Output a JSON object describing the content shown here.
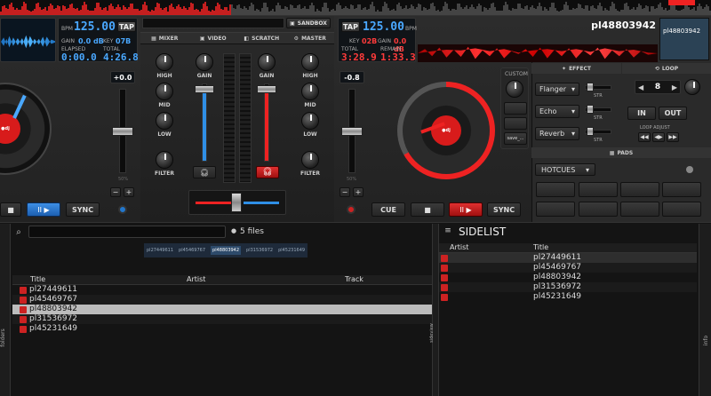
{
  "top_bar": {
    "sandbox_label": "SANDBOX"
  },
  "left_deck": {
    "bpm_label": "BPM",
    "bpm": "125.00",
    "tap": "TAP",
    "gain_label": "GAIN",
    "gain": "0.0 dB",
    "key_label": "KEY",
    "key": "07B",
    "elapsed_label": "ELAPSED",
    "elapsed": "0:00.0",
    "total_label": "TOTAL",
    "total": "4:26.8",
    "pitch": "+0.0",
    "pitch_pct": "50%",
    "sync": "SYNC"
  },
  "right_deck": {
    "tap": "TAP",
    "bpm": "125.00",
    "bpm_label": "BPM",
    "key_label": "KEY",
    "key": "02B",
    "gain_label": "GAIN",
    "gain": "0.0 dB",
    "total_label": "TOTAL",
    "total": "3:28.9",
    "remain_label": "REMAIN",
    "remain": "1:33.3",
    "title": "pl48803942",
    "cover_title": "pl48803942",
    "pitch": "-0.8",
    "pitch_pct": "50%",
    "custom_label": "CUSTOM",
    "save_label": "save_...",
    "cue": "CUE",
    "sync": "SYNC"
  },
  "mixer": {
    "tabs": [
      "MIXER",
      "VIDEO",
      "SCRATCH",
      "MASTER"
    ],
    "knob_labels": [
      "HIGH",
      "MID",
      "LOW",
      "FILTER"
    ],
    "gain_label": "GAIN"
  },
  "effects": {
    "effect_title": "EFFECT",
    "loop_title": "LOOP",
    "slots": [
      {
        "name": "Flanger",
        "param": "STR"
      },
      {
        "name": "Echo",
        "param": "STR"
      },
      {
        "name": "Reverb",
        "param": "STR"
      }
    ],
    "loop_value": "8",
    "in": "IN",
    "out": "OUT",
    "loop_adjust": "LOOP ADJUST",
    "pads_title": "PADS",
    "pads_mode": "HOTCUES"
  },
  "browser": {
    "file_count": "5 files",
    "columns": [
      "Title",
      "Artist",
      "Track"
    ],
    "rows": [
      "pl27449611",
      "pl45469767",
      "pl48803942",
      "pl31536972",
      "pl45231649"
    ],
    "selected_index": 2,
    "mini_tabs": [
      "pl27449611",
      "pl45469767",
      "pl48803942",
      "pl31536972",
      "pl45231649"
    ],
    "left_tab": "folders",
    "side_tab": "sideview"
  },
  "sidelist": {
    "title": "SIDELIST",
    "columns": [
      "Artist",
      "Title"
    ],
    "rows": [
      "pl27449611",
      "pl45469767",
      "pl48803942",
      "pl31536972",
      "pl45231649"
    ],
    "info_tab": "info"
  },
  "colors": {
    "accent_blue": "#4aa8ff",
    "accent_red": "#ff2a2a"
  }
}
